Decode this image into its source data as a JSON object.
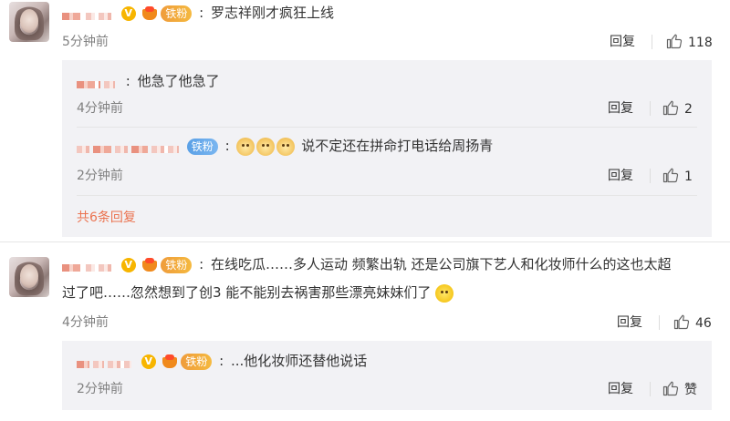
{
  "comments": [
    {
      "text": "罗志祥刚才疯狂上线",
      "time": "5分钟前",
      "reply_label": "回复",
      "likes": "118",
      "badge": "铁粉",
      "replies": [
        {
          "text": "他急了他急了",
          "time": "4分钟前",
          "reply_label": "回复",
          "likes": "2"
        },
        {
          "badge": "铁粉",
          "text": "说不定还在拼命打电话给周扬青",
          "time": "2分钟前",
          "reply_label": "回复",
          "likes": "1"
        }
      ],
      "more_replies": "共6条回复"
    },
    {
      "text_line1": "在线吃瓜……多人运动 频繁出轨 还是公司旗下艺人和化妆师什么的这也太超",
      "text_line2": "过了吧……忽然想到了创3 能不能别去祸害那些漂亮妹妹们了",
      "time": "4分钟前",
      "reply_label": "回复",
      "likes": "46",
      "badge": "铁粉",
      "replies": [
        {
          "badge": "铁粉",
          "text": "...他化妆师还替他说话",
          "time": "2分钟前",
          "reply_label": "回复",
          "likes": "赞"
        }
      ]
    }
  ],
  "colors": {
    "accent": "#eb7350",
    "time": "#808080",
    "sub_bg": "#f2f2f5",
    "badge_gold": "#f5b93f",
    "badge_blue": "#5aa0e6"
  },
  "icons": [
    "avatar",
    "vip-v-icon",
    "crown-icon",
    "thumb-up-icon",
    "doge-emoji-icon",
    "thinking-emoji-icon"
  ]
}
